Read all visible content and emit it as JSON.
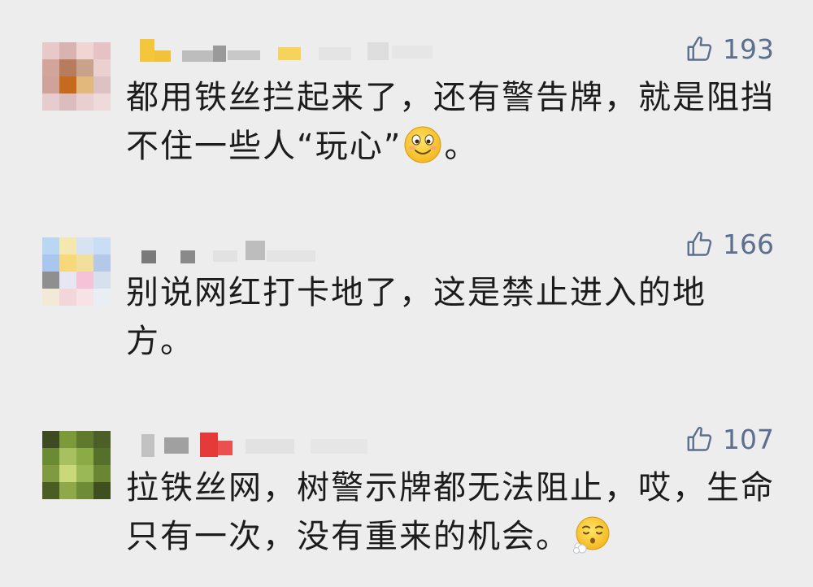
{
  "comments": [
    {
      "likes": "193",
      "text_before": "都用铁丝拦起来了，还有警告牌，就是阻挡不住一些人“玩心”",
      "emoji": "smile-emoji-icon",
      "text_after": "。"
    },
    {
      "likes": "166",
      "text_before": "别说网红打卡地了，这是禁止进入的地方。",
      "emoji": "",
      "text_after": ""
    },
    {
      "likes": "107",
      "text_before": "拉铁丝网，树警示牌都无法阻止，哎，生命只有一次，没有重来的机会。",
      "emoji": "sigh-emoji-icon",
      "text_after": ""
    }
  ],
  "colors": {
    "background": "#ededed",
    "like": "#5b6f8f",
    "text": "#1c1c1c"
  }
}
